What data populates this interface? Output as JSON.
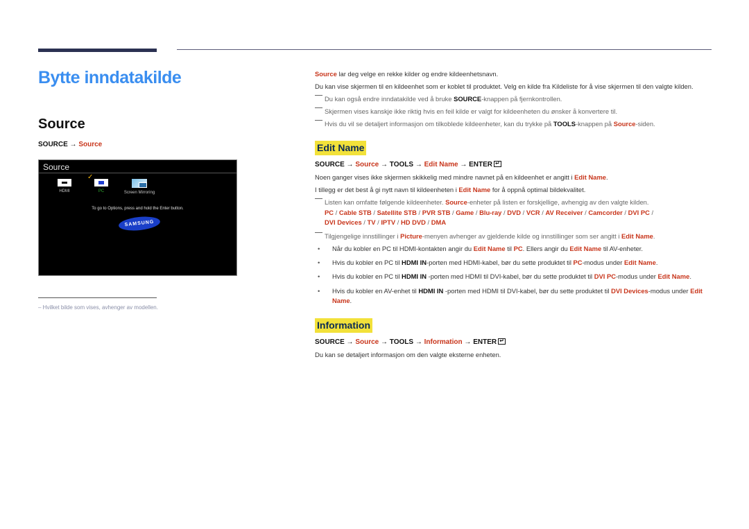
{
  "page": {
    "title": "Bytte inndatakilde",
    "section_title": "Source",
    "path": {
      "prefix": "SOURCE → ",
      "link": "Source"
    },
    "footnote": "Hvilket bilde som vises, avhenger av modellen."
  },
  "tv_screen": {
    "title": "Source",
    "sources": [
      {
        "label": "HDMI",
        "icon": "hdmi-icon"
      },
      {
        "label": "PC",
        "icon": "pc-icon",
        "selected": true
      },
      {
        "label": "Screen Mirroring",
        "icon": "screen-mirroring-icon"
      }
    ],
    "check_glyph": "✓",
    "hint": "To go to Options, press and hold the Enter button.",
    "logo": "SAMSUNG"
  },
  "intro": {
    "p1_link": "Source",
    "p1_rest": " lar deg velge en rekke kilder og endre kildeenhetsnavn.",
    "p2": "Du kan vise skjermen til en kildeenhet som er koblet til produktet. Velg en kilde fra Kildeliste for å vise skjermen til den valgte kilden.",
    "note1_a": "Du kan også endre inndatakilde ved å bruke ",
    "note1_b": "SOURCE",
    "note1_c": "-knappen på fjernkontrollen.",
    "note2": "Skjermen vises kanskje ikke riktig hvis en feil kilde er valgt for kildeenheten du ønsker å konvertere til.",
    "note3_a": "Hvis du vil se detaljert informasjon om tilkoblede kildeenheter, kan du trykke på ",
    "note3_b": "TOOLS",
    "note3_c": "-knappen på ",
    "note3_d": "Source",
    "note3_e": "-siden."
  },
  "edit_name": {
    "heading": "Edit Name",
    "path": {
      "a": "SOURCE → ",
      "b": "Source",
      "c": " → TOOLS → ",
      "d": "Edit Name",
      "e": " → ENTER"
    },
    "p1_a": "Noen ganger vises ikke skjermen skikkelig med mindre navnet på en kildeenhet er angitt i ",
    "p1_b": "Edit Name",
    "p1_c": ".",
    "p2_a": "I tillegg er det best å gi nytt navn til kildeenheten i ",
    "p2_b": "Edit Name",
    "p2_c": " for å oppnå optimal bildekvalitet.",
    "note1_a": "Listen kan omfatte følgende kildeenheter. ",
    "note1_b": "Source",
    "note1_c": "-enheter på listen er forskjellige, avhengig av den valgte kilden.",
    "devices": [
      "PC",
      "Cable STB",
      "Satellite STB",
      "PVR STB",
      "Game",
      "Blu-ray",
      "DVD",
      "VCR",
      "AV Receiver",
      "Camcorder",
      "DVI PC",
      "DVI Devices",
      "TV",
      "IPTV",
      "HD DVD",
      "DMA"
    ],
    "note2_a": "Tilgjengelige innstillinger i ",
    "note2_b": "Picture",
    "note2_c": "-menyen avhenger av gjeldende kilde og innstillinger som ser angitt i ",
    "note2_d": "Edit Name",
    "note2_e": ".",
    "bullets": [
      {
        "a": "Når du kobler en PC til HDMI-kontakten angir du ",
        "b": "Edit Name",
        "c": " til ",
        "d": "PC",
        "e": ". Ellers angir du ",
        "f": "Edit Name",
        "g": " til AV-enheter."
      },
      {
        "a": "Hvis du kobler en PC til ",
        "b": "HDMI IN",
        "c": "-porten med HDMI-kabel, bør du sette produktet til ",
        "d": "PC",
        "e": "-modus under ",
        "f": "Edit Name",
        "g": "."
      },
      {
        "a": "Hvis du kobler en PC til ",
        "b": "HDMI IN",
        "c": " -porten med HDMI til DVI-kabel, bør du sette produktet til ",
        "d": "DVI PC",
        "e": "-modus under ",
        "f": "Edit Name",
        "g": "."
      },
      {
        "a": "Hvis du kobler en AV-enhet til ",
        "b": "HDMI IN",
        "c": " -porten med HDMI til DVI-kabel, bør du sette produktet til ",
        "d": "DVI Devices",
        "e": "-modus under ",
        "f": "Edit Name",
        "g": "."
      }
    ]
  },
  "information": {
    "heading": "Information",
    "path": {
      "a": "SOURCE → ",
      "b": "Source",
      "c": " → TOOLS → ",
      "d": "Information",
      "e": " → ENTER"
    },
    "p1": "Du kan se detaljert informasjon om den valgte eksterne enheten."
  },
  "colors": {
    "title_blue": "#3a8ef0",
    "link_red": "#c8351b",
    "heading_highlight": "#f2e13a",
    "rule_navy": "#2b3152"
  }
}
